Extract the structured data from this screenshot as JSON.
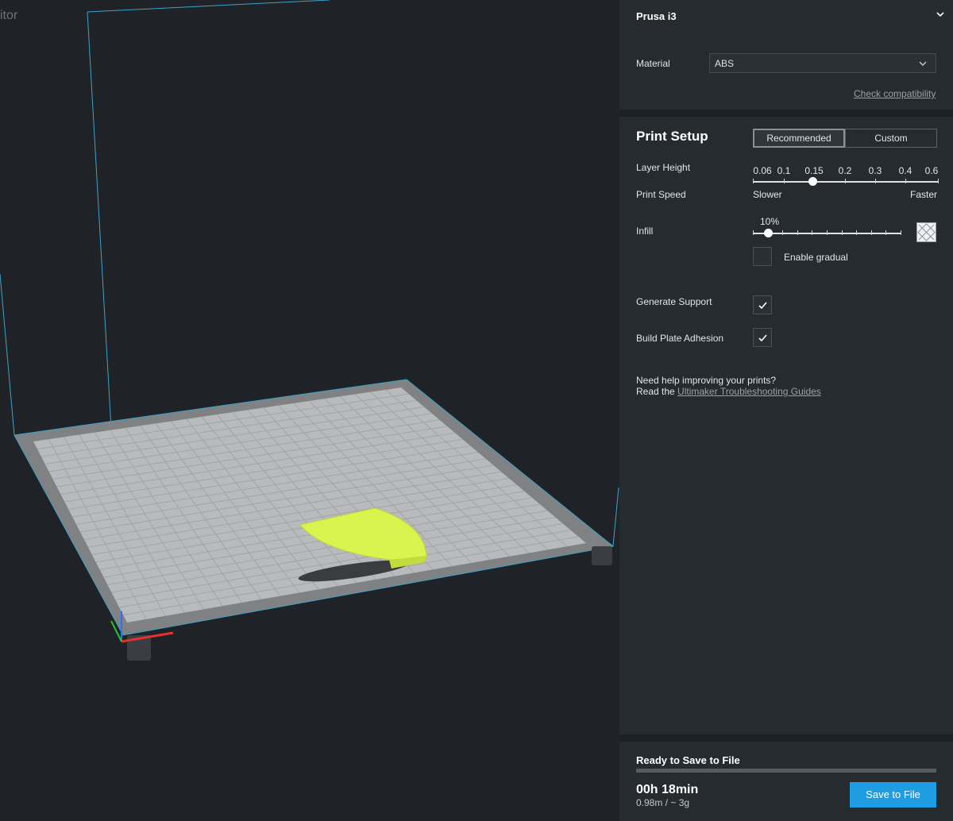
{
  "stage": {
    "title": "itor"
  },
  "machine": {
    "name": "Prusa i3",
    "chevron_icon": "chevron-down-icon"
  },
  "material": {
    "label": "Material",
    "value": "ABS",
    "check_link": "Check compatibility"
  },
  "print_setup": {
    "title": "Print Setup",
    "modes": [
      "Recommended",
      "Custom"
    ],
    "active_mode": "Recommended",
    "layer_height": {
      "label": "Layer Height",
      "ticks": [
        "0.06",
        "0.1",
        "0.15",
        "0.2",
        "0.3",
        "0.4",
        "0.6"
      ],
      "selected": "0.15"
    },
    "print_speed": {
      "label": "Print Speed",
      "slower": "Slower",
      "faster": "Faster"
    },
    "infill": {
      "label": "Infill",
      "value": "10%",
      "percent": 10,
      "pattern_icon": "infill-pattern-icon"
    },
    "gradual": {
      "label": "Enable gradual",
      "checked": false
    },
    "support": {
      "label": "Generate Support",
      "checked": true
    },
    "adhesion": {
      "label": "Build Plate Adhesion",
      "checked": true
    },
    "help": {
      "line1": "Need help improving your prints?",
      "line2_prefix": "Read the ",
      "link": "Ultimaker Troubleshooting Guides"
    }
  },
  "output": {
    "status": "Ready to Save to File",
    "progress": 1.0,
    "time": "00h 18min",
    "usage": "0.98m / ~ 3g",
    "save_button": "Save to File"
  },
  "colors": {
    "accent": "#1f9de2",
    "model": "#d9f34f",
    "build_volume": "#3da3c8"
  }
}
